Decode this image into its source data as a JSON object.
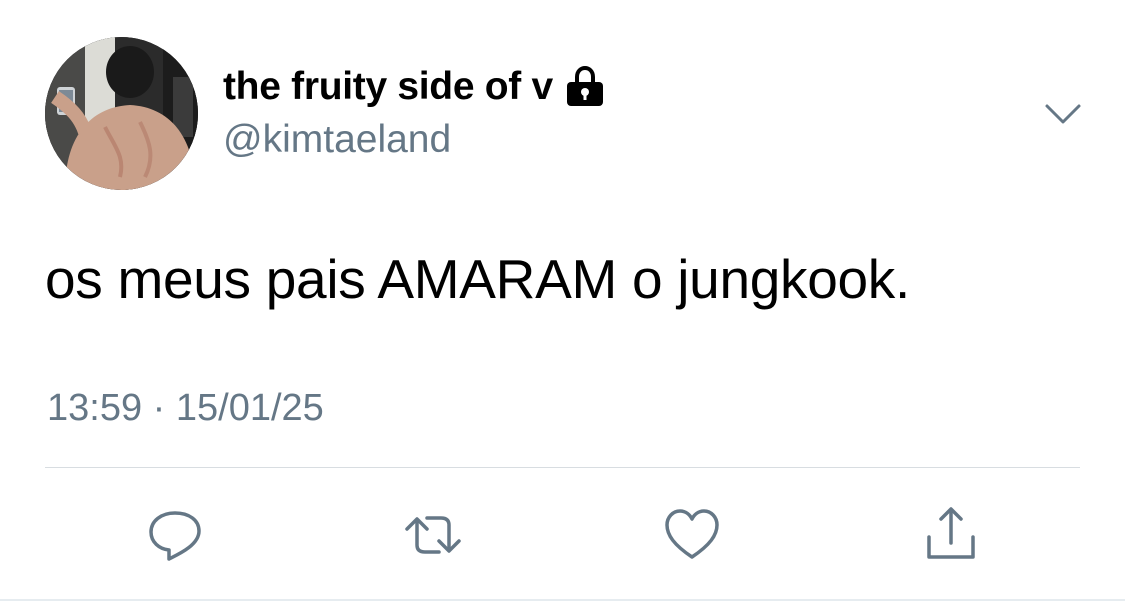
{
  "tweet": {
    "author": {
      "display_name": "the fruity side of v",
      "handle": "@kimtaeland",
      "avatar_icon": "avatar-photo",
      "protected_icon": "lock-icon"
    },
    "text": "os meus pais AMARAM o jungkook.",
    "timestamp": "13:59 · 15/01/25",
    "more_icon": "chevron-down-icon"
  },
  "actions": [
    {
      "name": "reply",
      "icon": "speech-bubble-icon"
    },
    {
      "name": "retweet",
      "icon": "retweet-arrows-icon"
    },
    {
      "name": "like",
      "icon": "heart-icon"
    },
    {
      "name": "share",
      "icon": "share-upload-icon"
    }
  ],
  "colors": {
    "text_primary": "#000000",
    "text_secondary": "#657786",
    "icon": "#657786",
    "divider": "#d8dde1",
    "background": "#ffffff"
  }
}
